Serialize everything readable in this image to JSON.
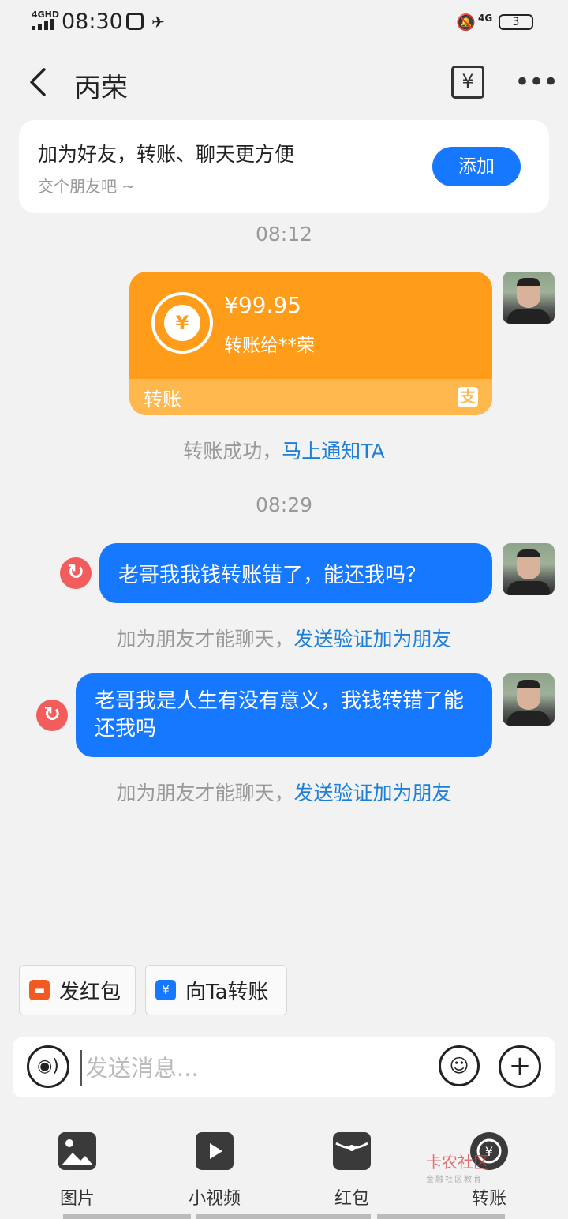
{
  "status_bar": {
    "network": "4GHD",
    "time": "08:30",
    "network2": "4G",
    "battery": "3"
  },
  "header": {
    "title": "丙荣"
  },
  "add_friend": {
    "title": "加为好友，转账、聊天更方便",
    "subtitle": "交个朋友吧 ~",
    "button": "添加"
  },
  "messages": {
    "ts1": "08:12",
    "transfer": {
      "amount": "¥99.95",
      "desc": "转账给**荣",
      "footer": "转账"
    },
    "transfer_tip": "转账成功，",
    "transfer_tip_link": "马上通知TA",
    "ts2": "08:29",
    "msg1": "老哥我我钱转账错了，能还我吗？",
    "msg1_tip": "加为朋友才能聊天，",
    "msg1_tip_link": "发送验证加为朋友",
    "msg2": "老哥我是人生有没有意义，我钱转错了能还我吗",
    "msg2_tip": "加为朋友才能聊天，",
    "msg2_tip_link": "发送验证加为朋友"
  },
  "quick_actions": {
    "red_packet": "发红包",
    "transfer": "向Ta转账"
  },
  "input": {
    "placeholder": "发送消息..."
  },
  "panel": {
    "items": [
      {
        "label": "图片",
        "icon": "image-icon"
      },
      {
        "label": "小视频",
        "icon": "video-icon"
      },
      {
        "label": "红包",
        "icon": "red-packet-icon"
      },
      {
        "label": "转账",
        "icon": "transfer-icon"
      }
    ]
  },
  "watermark": {
    "text": "卡农社区",
    "sub": "金融社区教育"
  },
  "colors": {
    "accent": "#1677ff",
    "transfer_orange": "#ff9d1a",
    "resend_red": "#f25c5c"
  }
}
